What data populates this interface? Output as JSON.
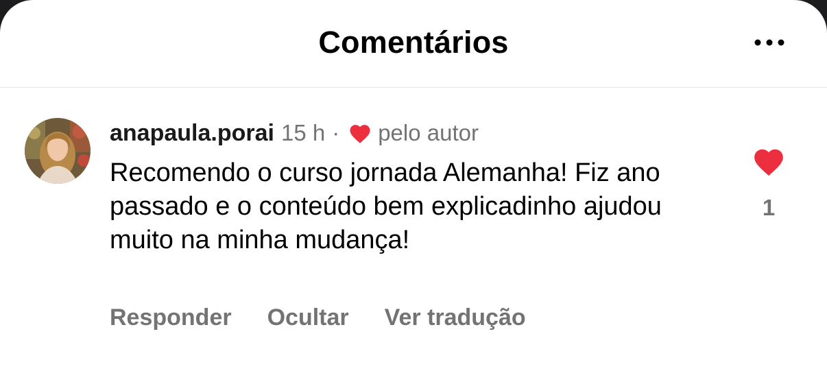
{
  "header": {
    "title": "Comentários",
    "more_icon": "ellipsis-icon"
  },
  "comment": {
    "username": "anapaula.porai",
    "time": "15 h",
    "separator": "·",
    "author_like_icon": "heart-icon",
    "author_like_label": "pelo autor",
    "text": "Recomendo o curso jornada Alemanha! Fiz ano passado e o conteúdo bem explicadinho ajudou muito na minha mudança!",
    "like_icon": "heart-icon",
    "like_count": "1",
    "actions": {
      "reply": "Responder",
      "hide": "Ocultar",
      "translate": "Ver tradução"
    }
  },
  "colors": {
    "heart": "#ed2e3f",
    "secondary_text": "#737373",
    "divider": "#e6e6e8"
  }
}
